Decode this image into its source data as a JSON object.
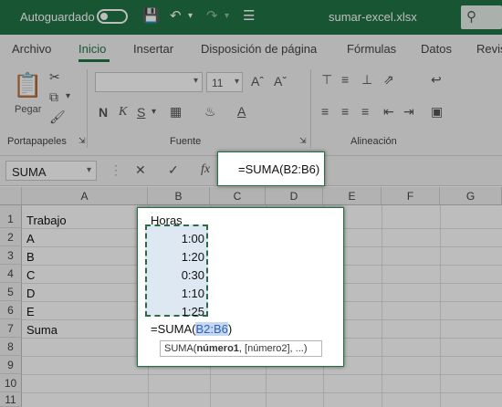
{
  "titlebar": {
    "autosave_label": "Autoguardado",
    "filename": "sumar-excel.xlsx"
  },
  "tabs": [
    "Archivo",
    "Inicio",
    "Insertar",
    "Disposición de página",
    "Fórmulas",
    "Datos",
    "Revis"
  ],
  "active_tab": "Inicio",
  "ribbon": {
    "paste_label": "Pegar",
    "font_size": "11",
    "groups": [
      "Portapapeles",
      "Fuente",
      "Alineación"
    ]
  },
  "formula_bar": {
    "name_box": "SUMA",
    "fx": "fx",
    "formula": "=SUMA(B2:B6)"
  },
  "grid": {
    "columns": [
      "A",
      "B",
      "C",
      "D",
      "E",
      "F",
      "G"
    ],
    "rows": [
      "1",
      "2",
      "3",
      "4",
      "5",
      "6",
      "7",
      "8",
      "9",
      "10",
      "11"
    ],
    "colA": [
      "Trabajo",
      "A",
      "B",
      "C",
      "D",
      "E",
      "Suma"
    ],
    "colB_header": "Horas",
    "colB_values": [
      "1:00",
      "1:20",
      "0:30",
      "1:10",
      "1:25"
    ],
    "edit_prefix": "=SUMA(",
    "edit_ref": "B2:B6",
    "edit_suffix": ")",
    "tooltip_fn": "SUMA(",
    "tooltip_arg1": "número1",
    "tooltip_rest": ", [número2], ...)"
  },
  "colors": {
    "excel_green": "#217346",
    "selection_fill": "#dde8f3",
    "reference_blue": "#2f62b1"
  }
}
